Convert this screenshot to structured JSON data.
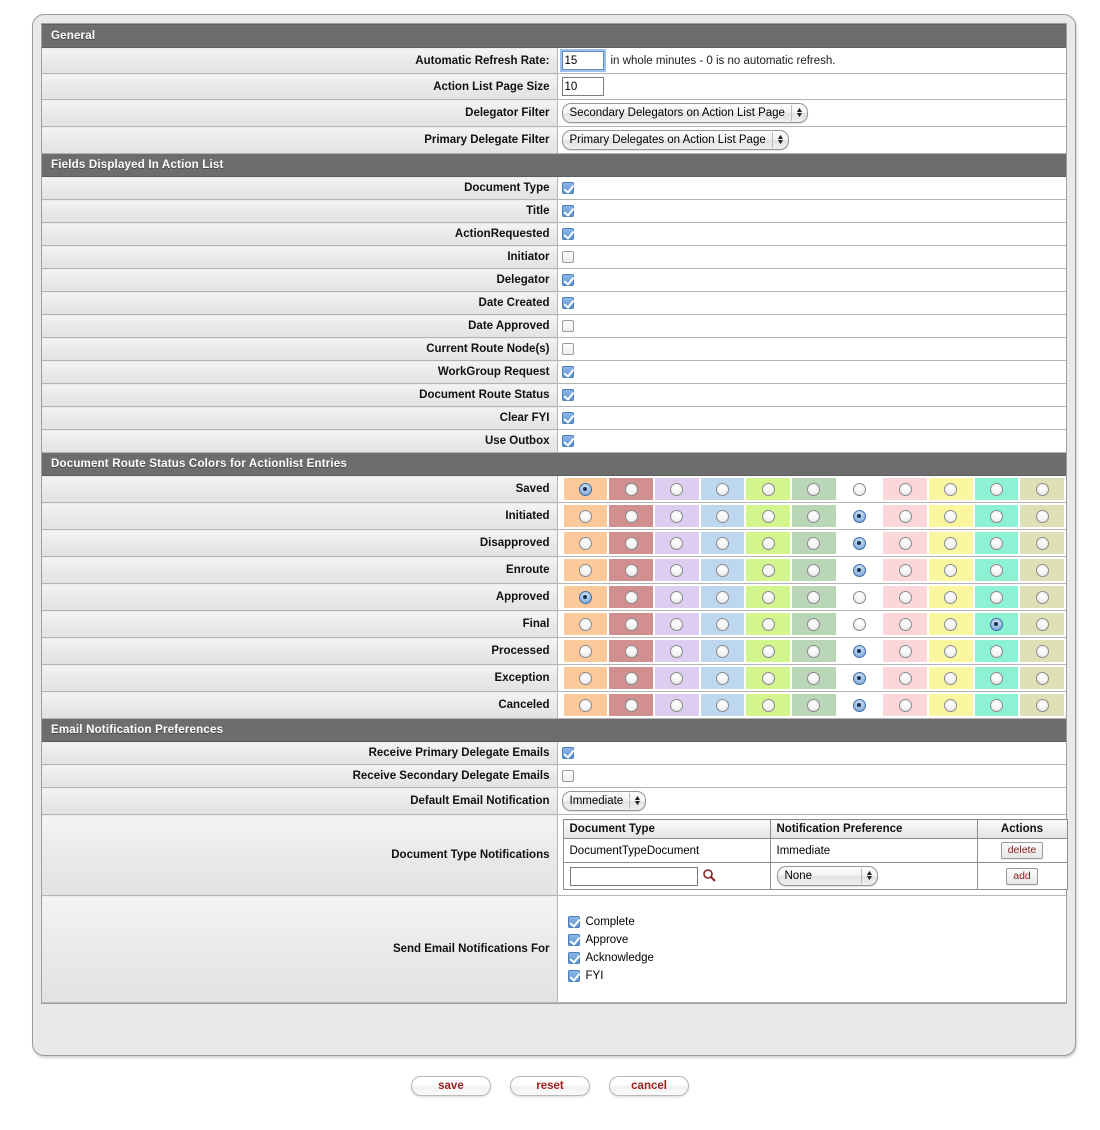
{
  "sections": {
    "general": {
      "title": "General",
      "rows": {
        "refresh_label": "Automatic Refresh Rate:",
        "refresh_value": "15",
        "refresh_hint": "in whole minutes - 0 is no automatic refresh.",
        "page_size_label": "Action List Page Size",
        "page_size_value": "10",
        "delegator_label": "Delegator Filter",
        "delegator_value": "Secondary Delegators on Action List Page",
        "primary_delegate_label": "Primary Delegate Filter",
        "primary_delegate_value": "Primary Delegates on Action List Page"
      }
    },
    "fields_displayed": {
      "title": "Fields Displayed In Action List",
      "items": [
        {
          "label": "Document Type",
          "checked": true
        },
        {
          "label": "Title",
          "checked": true
        },
        {
          "label": "ActionRequested",
          "checked": true
        },
        {
          "label": "Initiator",
          "checked": false
        },
        {
          "label": "Delegator",
          "checked": true
        },
        {
          "label": "Date Created",
          "checked": true
        },
        {
          "label": "Date Approved",
          "checked": false
        },
        {
          "label": "Current Route Node(s)",
          "checked": false
        },
        {
          "label": "WorkGroup Request",
          "checked": true
        },
        {
          "label": "Document Route Status",
          "checked": true
        },
        {
          "label": "Clear FYI",
          "checked": true
        },
        {
          "label": "Use Outbox",
          "checked": true
        }
      ]
    },
    "route_status_colors": {
      "title": "Document Route Status Colors for Actionlist Entries",
      "palette": [
        {
          "name": "orange",
          "hex": "#fbc99a"
        },
        {
          "name": "dark-rose",
          "hex": "#d18f8f"
        },
        {
          "name": "lavender",
          "hex": "#ddcdf0"
        },
        {
          "name": "light-blue",
          "hex": "#bcd7ee"
        },
        {
          "name": "yellow-green",
          "hex": "#d2f58e"
        },
        {
          "name": "sage-green",
          "hex": "#b9d6b6"
        },
        {
          "name": "white",
          "hex": "#ffffff"
        },
        {
          "name": "pink",
          "hex": "#fbd7da"
        },
        {
          "name": "yellow",
          "hex": "#fbf7a0"
        },
        {
          "name": "turquoise",
          "hex": "#8df2d4"
        },
        {
          "name": "khaki",
          "hex": "#e0e0b6"
        }
      ],
      "rows": [
        {
          "label": "Saved",
          "selected": 0
        },
        {
          "label": "Initiated",
          "selected": 6
        },
        {
          "label": "Disapproved",
          "selected": 6
        },
        {
          "label": "Enroute",
          "selected": 6
        },
        {
          "label": "Approved",
          "selected": 0
        },
        {
          "label": "Final",
          "selected": 9
        },
        {
          "label": "Processed",
          "selected": 6
        },
        {
          "label": "Exception",
          "selected": 6
        },
        {
          "label": "Canceled",
          "selected": 6
        }
      ]
    },
    "email_prefs": {
      "title": "Email Notification Preferences",
      "primary_delegate_label": "Receive Primary Delegate Emails",
      "primary_delegate_checked": true,
      "secondary_delegate_label": "Receive Secondary Delegate Emails",
      "secondary_delegate_checked": false,
      "default_notification_label": "Default Email Notification",
      "default_notification_value": "Immediate",
      "doc_type_notifications_label": "Document Type Notifications",
      "doc_type_table": {
        "headers": [
          "Document Type",
          "Notification Preference",
          "Actions"
        ],
        "rows": [
          {
            "document_type": "DocumentTypeDocument",
            "notification_preference": "Immediate",
            "action_label": "delete"
          }
        ],
        "add_row": {
          "document_type_value": "",
          "search_icon": "magnifier-icon",
          "notification_preference_value": "None",
          "action_label": "add"
        }
      },
      "send_for_label": "Send Email Notifications For",
      "send_for_items": [
        {
          "label": "Complete",
          "checked": true
        },
        {
          "label": "Approve",
          "checked": true
        },
        {
          "label": "Acknowledge",
          "checked": true
        },
        {
          "label": "FYI",
          "checked": true
        }
      ]
    }
  },
  "buttons": {
    "save": "save",
    "reset": "reset",
    "cancel": "cancel"
  }
}
